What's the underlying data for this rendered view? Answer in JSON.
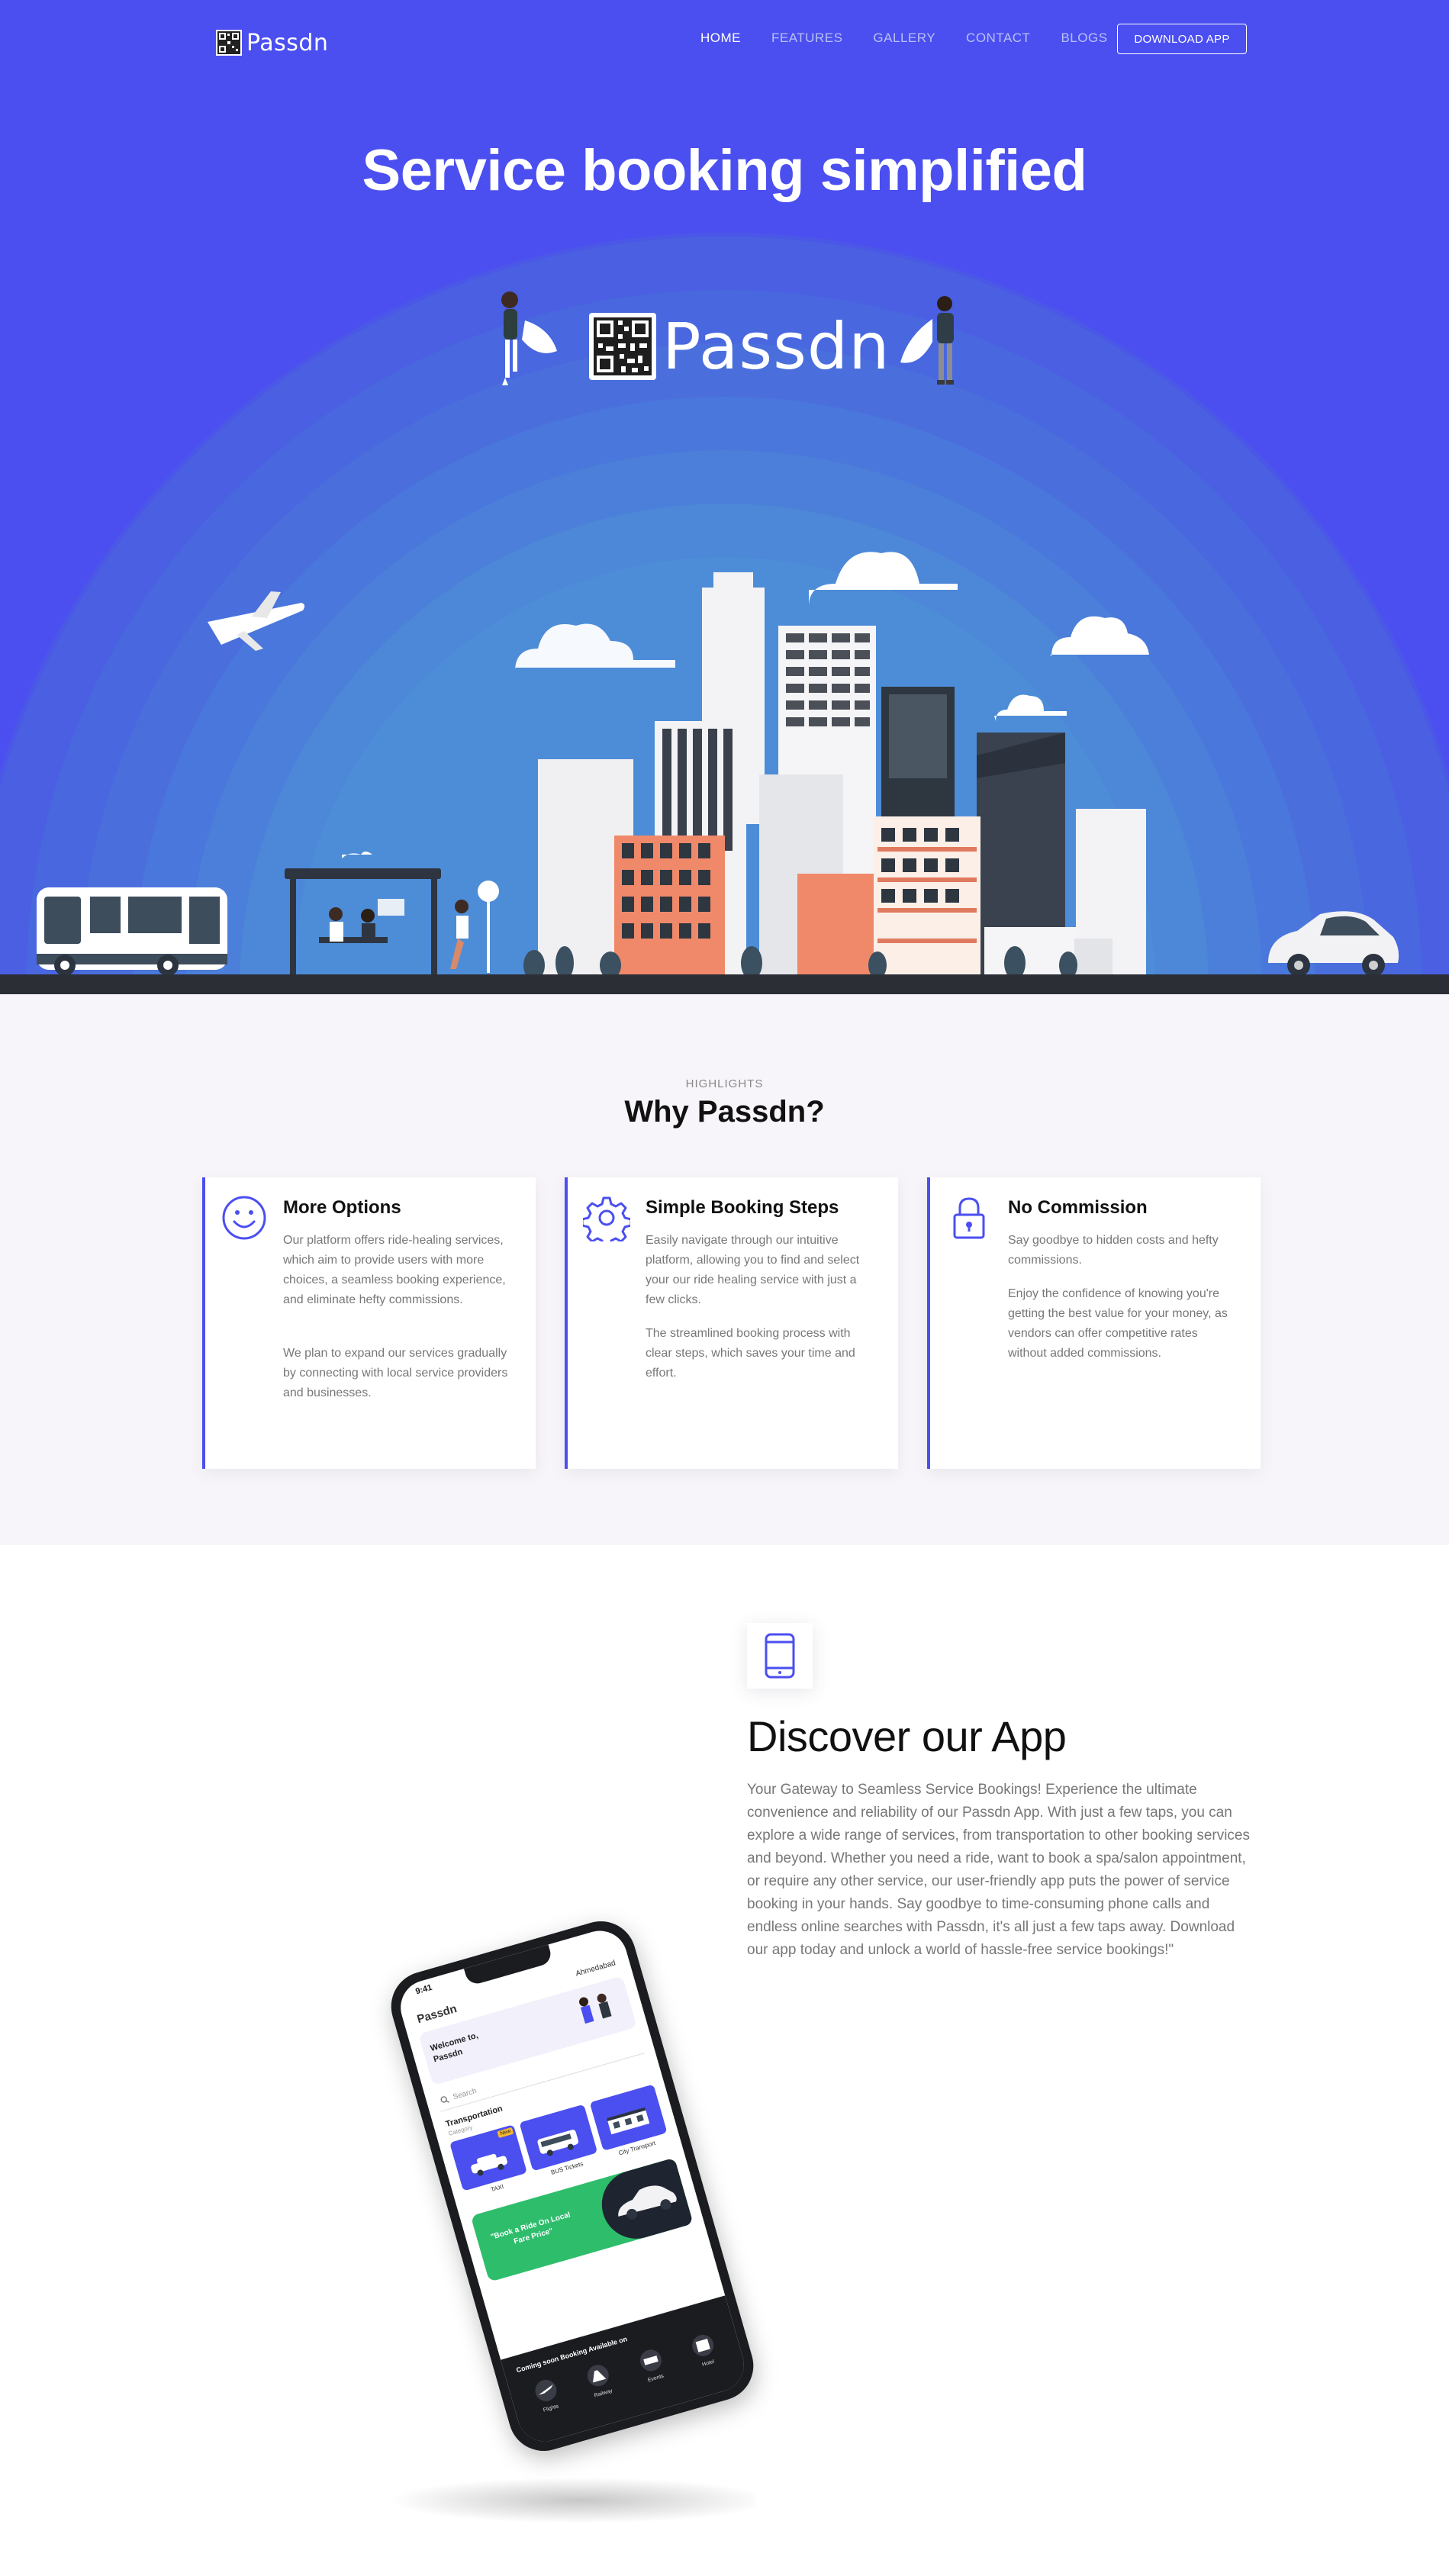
{
  "nav": {
    "logo_text": "Passdn",
    "links": [
      "HOME",
      "FEATURES",
      "GALLERY",
      "CONTACT",
      "BLOGS"
    ],
    "cta": "DOWNLOAD APP"
  },
  "hero": {
    "title": "Service booking simplified",
    "brand": "Passdn"
  },
  "highlights": {
    "eyebrow": "HIGHLIGHTS",
    "title": "Why Passdn?",
    "cards": [
      {
        "title": "More Options",
        "icon": "smile-icon",
        "p1": "Our platform offers ride-healing services, which aim to provide users with more choices, a seamless booking experience, and eliminate hefty commissions.",
        "p2": "We plan to expand our services gradually by connecting with local service providers and businesses."
      },
      {
        "title": "Simple Booking Steps",
        "icon": "gear-icon",
        "p1": "Easily navigate through our intuitive platform, allowing you to find and select your our ride healing service with just a few clicks.",
        "p2": "The streamlined booking process with clear steps, which saves your time and effort."
      },
      {
        "title": "No Commission",
        "icon": "lock-icon",
        "p1": "Say goodbye to hidden costs and hefty commissions.",
        "p2": "Enjoy the confidence of knowing you're getting the best value for your money, as vendors can offer competitive rates without added commissions."
      }
    ]
  },
  "discover": {
    "icon": "mobile-icon",
    "title": "Discover our App",
    "text": "Your Gateway to Seamless Service Bookings! Experience the ultimate convenience and reliability of our Passdn App. With just a few taps, you can explore a wide range of services, from transportation to other booking services and beyond. Whether you need a ride, want to book a spa/salon appointment, or require any other service, our user-friendly app puts the power of service booking in your hands. Say goodbye to time-consuming phone calls and endless online searches with Passdn, it's all just a few taps away. Download our app today and unlock a world of hassle-free service bookings!\""
  },
  "phone": {
    "time": "9:41",
    "brand": "Passdn",
    "location": "Ahmedabad",
    "welcome": "Welcome to, Passdn",
    "search_placeholder": "Search",
    "section_title": "Transportation",
    "section_sub": "Category",
    "badge": "New",
    "tiles": [
      "TAXI",
      "BUS Tickets",
      "City Transport"
    ],
    "banner": "\"Book a Ride On Local Fare Price\"",
    "coming_soon": "Coming soon Booking Available on",
    "upcoming": [
      "Flights",
      "Railway",
      "Events",
      "Hotel"
    ]
  },
  "colors": {
    "primary": "#4b4ff0",
    "banner_green": "#2ebd6b",
    "text_muted": "#777777"
  }
}
